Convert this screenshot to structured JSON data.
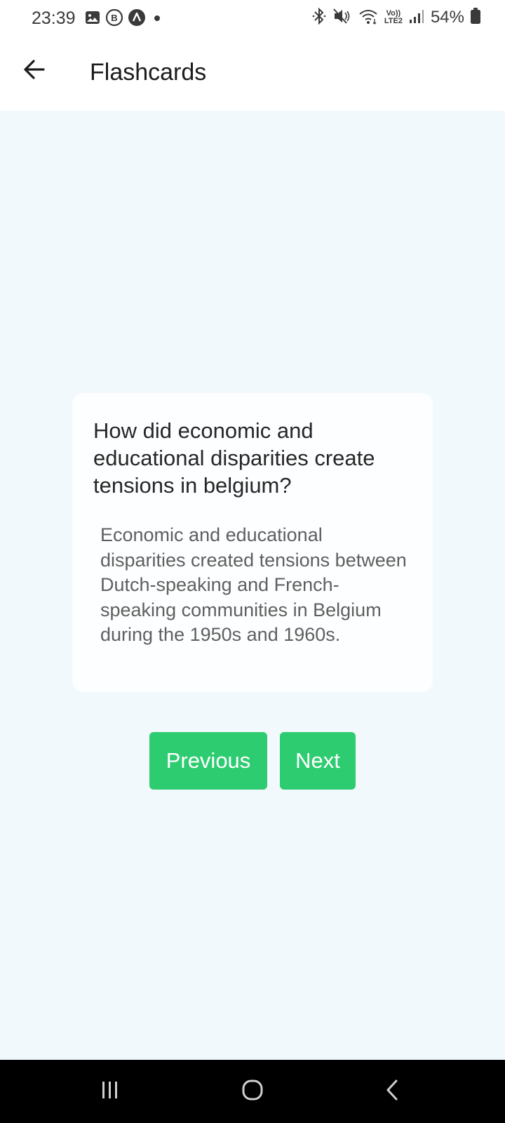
{
  "status_bar": {
    "time": "23:39",
    "battery_percent": "54%",
    "network_top": "Vo))",
    "network_bottom": "LTE2",
    "icons": [
      "gallery-icon",
      "b-circle-icon",
      "a-circle-icon",
      "notification-dot-icon",
      "bluetooth-icon",
      "mute-icon",
      "wifi-icon",
      "signal-icon",
      "battery-icon"
    ]
  },
  "app_bar": {
    "title": "Flashcards",
    "back_icon": "arrow-left-icon"
  },
  "flashcard": {
    "question": "How did economic and educational disparities create tensions in belgium?",
    "answer": "Economic and educational disparities created tensions between Dutch-speaking and French-speaking communities in Belgium during the 1950s and 1960s."
  },
  "buttons": {
    "previous_label": "Previous",
    "next_label": "Next"
  },
  "colors": {
    "accent": "#2ecc71",
    "background": "#f2f9fd",
    "card": "#fdfeff"
  },
  "nav_bar": {
    "icons": [
      "recents-icon",
      "home-icon",
      "back-icon"
    ]
  }
}
